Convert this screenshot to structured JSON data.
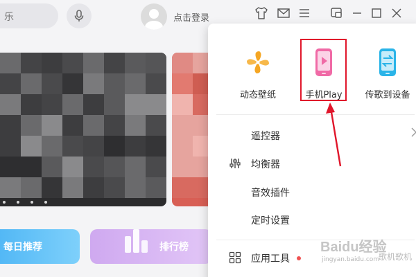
{
  "header": {
    "search_text": "乐",
    "login_label": "点击登录",
    "icons": [
      "mic-icon",
      "avatar-icon",
      "skin-icon",
      "mail-icon",
      "menu-icon",
      "mini-mode-icon",
      "minimize-icon",
      "maximize-icon",
      "close-icon"
    ]
  },
  "home": {
    "tiles": [
      {
        "label": "每日推荐",
        "color": "#4fb6f5"
      },
      {
        "label": "排行榜",
        "color": "#cfa9f0"
      }
    ]
  },
  "menu": {
    "features": [
      {
        "label": "动态壁纸",
        "icon": "pinwheel-icon",
        "color": "#f5a623"
      },
      {
        "label": "手机Play",
        "icon": "phone-play-icon",
        "color": "#f06aa6"
      },
      {
        "label": "传歌到设备",
        "icon": "transfer-icon",
        "color": "#2ab4e8"
      }
    ],
    "items": [
      {
        "label": "遥控器",
        "icon": ""
      },
      {
        "label": "均衡器",
        "icon": "equalizer-icon"
      },
      {
        "label": "音效插件",
        "icon": ""
      },
      {
        "label": "定时设置",
        "icon": ""
      },
      {
        "label": "应用工具",
        "icon": "apps-grid-icon"
      }
    ],
    "highlight_color": "#e0162b"
  },
  "watermark": {
    "logo": "Baidu经验",
    "url": "jingyan.baidu.com",
    "sub": "歌机歌机"
  }
}
